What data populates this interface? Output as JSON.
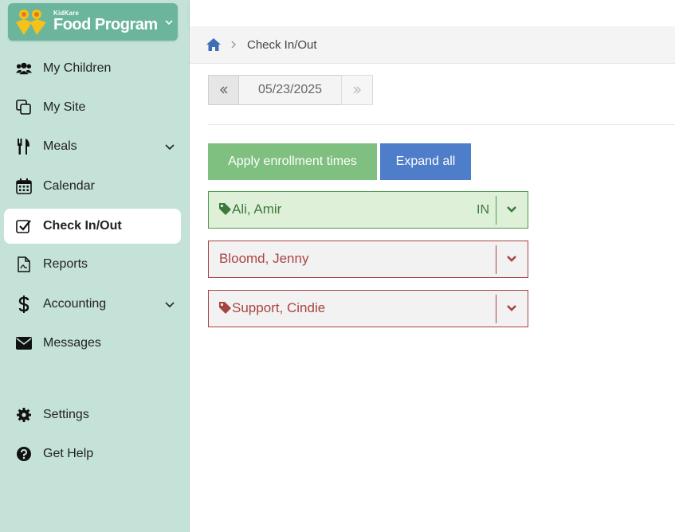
{
  "logo": {
    "small_text": "KidKare",
    "big_text": "Food Program"
  },
  "sidebar": {
    "items": [
      {
        "label": "My Children",
        "icon": "users-icon",
        "has_chevron": false,
        "active": false
      },
      {
        "label": "My Site",
        "icon": "copy-icon",
        "has_chevron": false,
        "active": false
      },
      {
        "label": "Meals",
        "icon": "utensils-icon",
        "has_chevron": true,
        "active": false
      },
      {
        "label": "Calendar",
        "icon": "calendar-icon",
        "has_chevron": false,
        "active": false
      },
      {
        "label": "Check In/Out",
        "icon": "check-square-icon",
        "has_chevron": false,
        "active": true
      },
      {
        "label": "Reports",
        "icon": "pdf-file-icon",
        "has_chevron": false,
        "active": false
      },
      {
        "label": "Accounting",
        "icon": "dollar-icon",
        "has_chevron": true,
        "active": false
      },
      {
        "label": "Messages",
        "icon": "envelope-icon",
        "has_chevron": false,
        "active": false
      },
      {
        "label": "Settings",
        "icon": "gear-icon",
        "has_chevron": false,
        "active": false
      },
      {
        "label": "Get Help",
        "icon": "question-circle-icon",
        "has_chevron": false,
        "active": false
      }
    ]
  },
  "breadcrumb": {
    "current": "Check In/Out"
  },
  "date_picker": {
    "value": "05/23/2025"
  },
  "actions": {
    "apply_label": "Apply enrollment times",
    "expand_label": "Expand all"
  },
  "children": [
    {
      "name": "Ali, Amir",
      "status": "IN",
      "tagged": true,
      "state": "in"
    },
    {
      "name": "Bloomd, Jenny",
      "status": "",
      "tagged": false,
      "state": "out"
    },
    {
      "name": "Support, Cindie",
      "status": "",
      "tagged": true,
      "state": "out"
    }
  ],
  "colors": {
    "sidebar_bg": "#c5e2d8",
    "logo_bg": "#6bb59c",
    "apply_button": "#7fbf7f",
    "expand_button": "#4e7dc9",
    "checked_in": "#3c7a3c",
    "not_checked_in": "#a94442"
  }
}
